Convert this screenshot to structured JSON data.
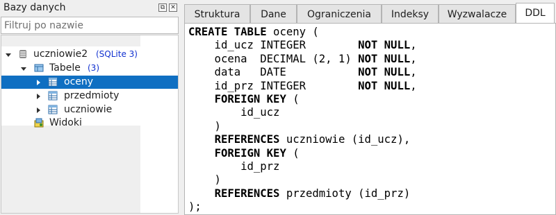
{
  "left_panel": {
    "title": "Bazy danych",
    "filter_placeholder": "Filtruj po nazwie",
    "tree": {
      "database": {
        "label": "uczniowie2",
        "note": "(SQLite 3)"
      },
      "tables_group": {
        "label": "Tabele",
        "count": "(3)"
      },
      "tables": [
        {
          "label": "oceny",
          "selected": true
        },
        {
          "label": "przedmioty",
          "selected": false
        },
        {
          "label": "uczniowie",
          "selected": false
        }
      ],
      "views_group": {
        "label": "Widoki"
      }
    },
    "icons": {
      "float": "float-panel-icon",
      "close": "close-panel-icon",
      "database": "database-icon",
      "tables": "tables-folder-icon",
      "table": "table-icon",
      "views": "views-icon"
    },
    "colors": {
      "selection": "#0f6fc2",
      "note": "#1030d0"
    }
  },
  "tabs": [
    {
      "label": "Struktura",
      "active": false
    },
    {
      "label": "Dane",
      "active": false
    },
    {
      "label": "Ograniczenia",
      "active": false
    },
    {
      "label": "Indeksy",
      "active": false
    },
    {
      "label": "Wyzwalacze",
      "active": false
    },
    {
      "label": "DDL",
      "active": true
    }
  ],
  "ddl": {
    "lines": [
      [
        {
          "t": "CREATE TABLE",
          "b": true
        },
        {
          "t": " oceny ("
        }
      ],
      [
        {
          "t": "    id_ucz INTEGER        "
        },
        {
          "t": "NOT NULL",
          "b": true
        },
        {
          "t": ","
        }
      ],
      [
        {
          "t": "    ocena  DECIMAL (2, 1) "
        },
        {
          "t": "NOT NULL",
          "b": true
        },
        {
          "t": ","
        }
      ],
      [
        {
          "t": "    data   DATE           "
        },
        {
          "t": "NOT NULL",
          "b": true
        },
        {
          "t": ","
        }
      ],
      [
        {
          "t": "    id_prz INTEGER        "
        },
        {
          "t": "NOT NULL",
          "b": true
        },
        {
          "t": ","
        }
      ],
      [
        {
          "t": "    "
        },
        {
          "t": "FOREIGN KEY",
          "b": true
        },
        {
          "t": " ("
        }
      ],
      [
        {
          "t": "        id_ucz"
        }
      ],
      [
        {
          "t": "    )"
        }
      ],
      [
        {
          "t": "    "
        },
        {
          "t": "REFERENCES",
          "b": true
        },
        {
          "t": " uczniowie (id_ucz),"
        }
      ],
      [
        {
          "t": "    "
        },
        {
          "t": "FOREIGN KEY",
          "b": true
        },
        {
          "t": " ("
        }
      ],
      [
        {
          "t": "        id_prz"
        }
      ],
      [
        {
          "t": "    )"
        }
      ],
      [
        {
          "t": "    "
        },
        {
          "t": "REFERENCES",
          "b": true
        },
        {
          "t": " przedmioty (id_prz)"
        }
      ],
      [
        {
          "t": ");"
        }
      ]
    ]
  }
}
